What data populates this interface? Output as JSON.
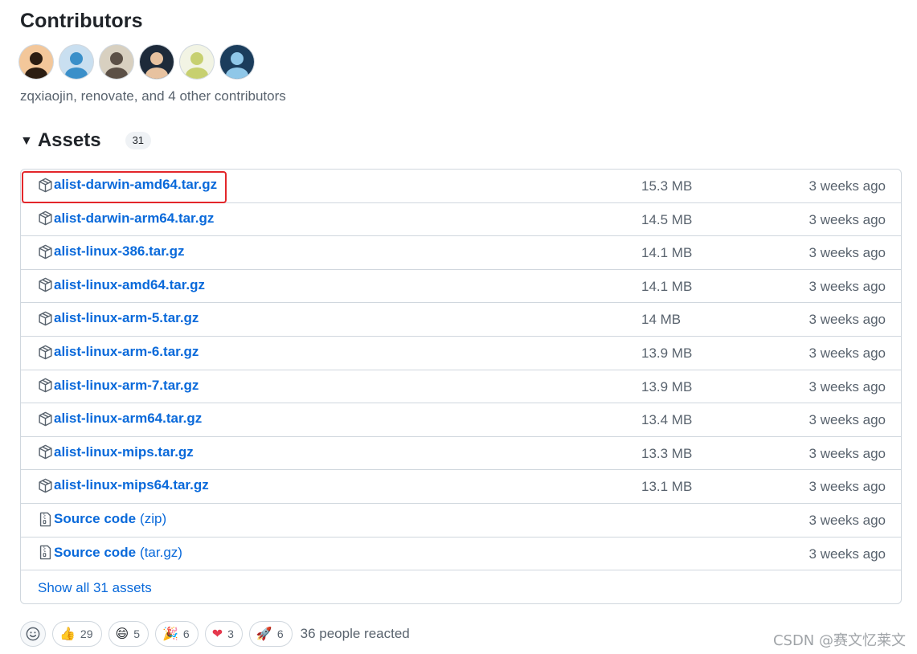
{
  "contributors": {
    "title": "Contributors",
    "summary": "zqxiaojin, renovate, and 4 other contributors",
    "avatars": [
      {
        "bg": "#f3c79a",
        "fg": "#2b1d12"
      },
      {
        "bg": "#c9dff0",
        "fg": "#3a8fc9"
      },
      {
        "bg": "#d8d0c0",
        "fg": "#5b5046"
      },
      {
        "bg": "#1d2a3a",
        "fg": "#e7c2a0"
      },
      {
        "bg": "#f2f4e4",
        "fg": "#c7d070"
      },
      {
        "bg": "#1b3d5c",
        "fg": "#8fc7e8"
      }
    ]
  },
  "assets": {
    "title": "Assets",
    "count": "31",
    "show_all_label": "Show all 31 assets",
    "rows": [
      {
        "name": "alist-darwin-amd64.tar.gz",
        "suffix": "",
        "size": "15.3 MB",
        "time": "3 weeks ago",
        "icon": "package-icon"
      },
      {
        "name": "alist-darwin-arm64.tar.gz",
        "suffix": "",
        "size": "14.5 MB",
        "time": "3 weeks ago",
        "icon": "package-icon"
      },
      {
        "name": "alist-linux-386.tar.gz",
        "suffix": "",
        "size": "14.1 MB",
        "time": "3 weeks ago",
        "icon": "package-icon"
      },
      {
        "name": "alist-linux-amd64.tar.gz",
        "suffix": "",
        "size": "14.1 MB",
        "time": "3 weeks ago",
        "icon": "package-icon"
      },
      {
        "name": "alist-linux-arm-5.tar.gz",
        "suffix": "",
        "size": "14 MB",
        "time": "3 weeks ago",
        "icon": "package-icon"
      },
      {
        "name": "alist-linux-arm-6.tar.gz",
        "suffix": "",
        "size": "13.9 MB",
        "time": "3 weeks ago",
        "icon": "package-icon"
      },
      {
        "name": "alist-linux-arm-7.tar.gz",
        "suffix": "",
        "size": "13.9 MB",
        "time": "3 weeks ago",
        "icon": "package-icon"
      },
      {
        "name": "alist-linux-arm64.tar.gz",
        "suffix": "",
        "size": "13.4 MB",
        "time": "3 weeks ago",
        "icon": "package-icon"
      },
      {
        "name": "alist-linux-mips.tar.gz",
        "suffix": "",
        "size": "13.3 MB",
        "time": "3 weeks ago",
        "icon": "package-icon"
      },
      {
        "name": "alist-linux-mips64.tar.gz",
        "suffix": "",
        "size": "13.1 MB",
        "time": "3 weeks ago",
        "icon": "package-icon"
      },
      {
        "name": "Source code",
        "suffix": "(zip)",
        "size": "",
        "time": "3 weeks ago",
        "icon": "file-zip-icon"
      },
      {
        "name": "Source code",
        "suffix": "(tar.gz)",
        "size": "",
        "time": "3 weeks ago",
        "icon": "file-zip-icon"
      }
    ]
  },
  "reactions": {
    "items": [
      {
        "emoji": "👍",
        "count": "29",
        "name": "thumbs-up"
      },
      {
        "emoji": "😄",
        "count": "5",
        "name": "laugh"
      },
      {
        "emoji": "🎉",
        "count": "6",
        "name": "hooray"
      },
      {
        "emoji": "❤",
        "count": "3",
        "name": "heart"
      },
      {
        "emoji": "🚀",
        "count": "6",
        "name": "rocket"
      }
    ],
    "summary": "36 people reacted"
  },
  "watermark": "CSDN @赛文忆莱文",
  "colors": {
    "link": "#0969da",
    "muted": "#59636e",
    "border": "#d0d7de",
    "highlight": "#e3262a"
  }
}
